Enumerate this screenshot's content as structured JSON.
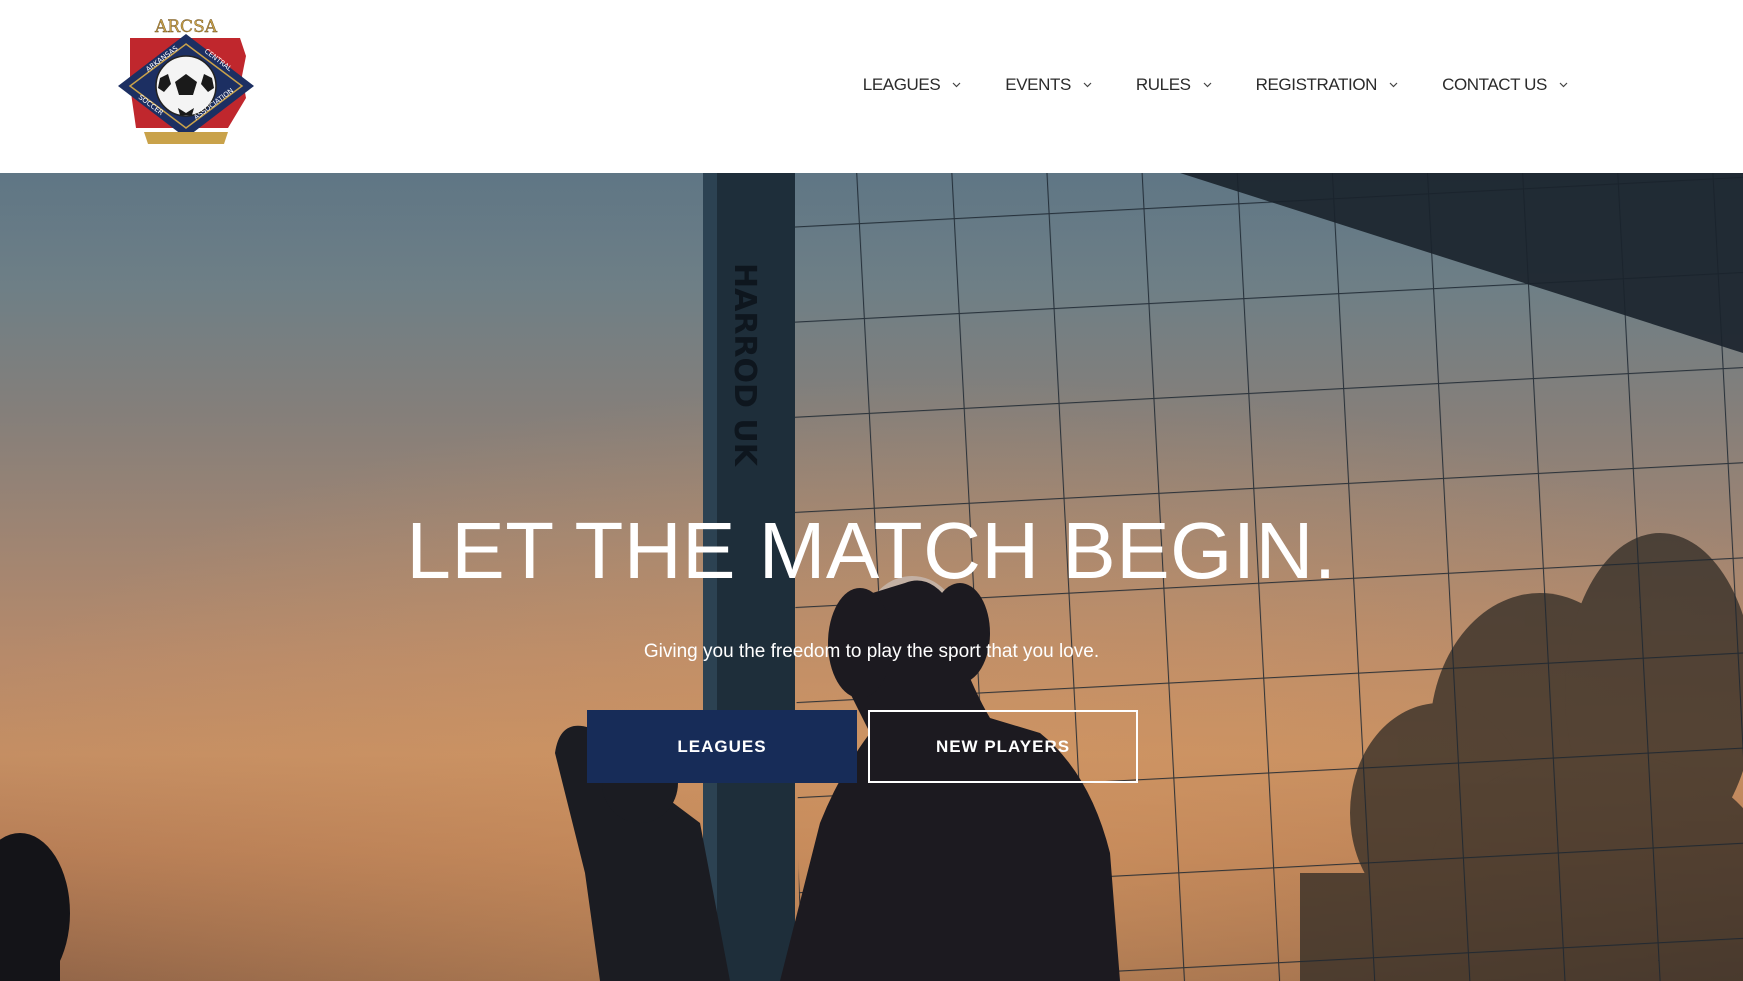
{
  "logo": {
    "text_top": "ARCSA",
    "text_ring_left": "ARKANSAS",
    "text_ring_right": "CENTRAL",
    "text_bottom_left": "SOCCER",
    "text_bottom_right": "ASSOCIATION",
    "icon": "soccer-ball-icon",
    "colors": {
      "navy": "#1c2f62",
      "red": "#c0272d",
      "gold": "#c9a24a"
    }
  },
  "nav": {
    "items": [
      {
        "label": "LEAGUES",
        "icon": "chevron-down-icon"
      },
      {
        "label": "EVENTS",
        "icon": "chevron-down-icon"
      },
      {
        "label": "RULES",
        "icon": "chevron-down-icon"
      },
      {
        "label": "REGISTRATION",
        "icon": "chevron-down-icon"
      },
      {
        "label": "CONTACT US",
        "icon": "chevron-down-icon"
      }
    ]
  },
  "hero": {
    "headline": "LET THE MATCH BEGIN.",
    "subline": "Giving you the freedom to play the sport that you love.",
    "primary_button": "LEAGUES",
    "secondary_button": "NEW PLAYERS",
    "post_text": "HARROD UK",
    "colors": {
      "button_primary": "#172c58",
      "text": "#ffffff"
    }
  }
}
